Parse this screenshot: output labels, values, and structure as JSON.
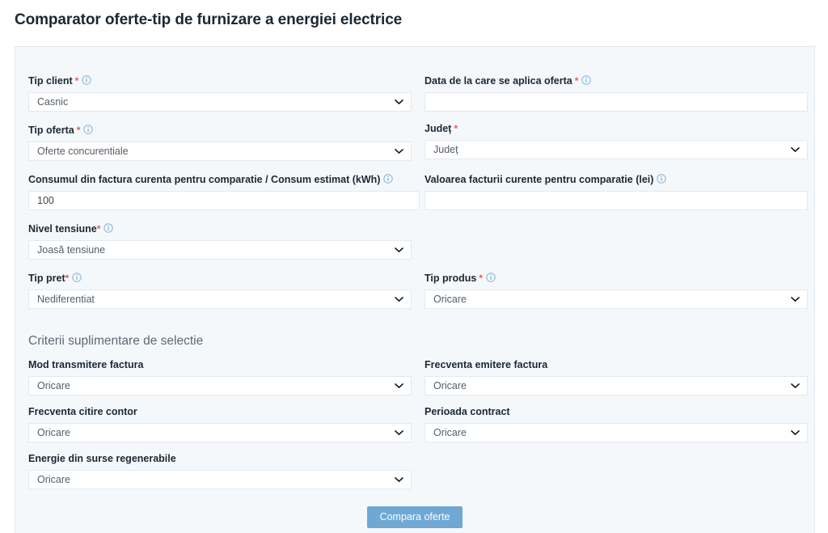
{
  "page": {
    "title": "Comparator oferte-tip de furnizare a energiei electrice"
  },
  "icons": {
    "info": "info-circle-icon",
    "chevron": "chevron-down-icon"
  },
  "colors": {
    "accent_button": "#6ea8d3",
    "required_asterisk": "#e45b5b",
    "card_background": "#f5f8fb",
    "info_icon": "#7fb3d9",
    "title_text": "#1b2733",
    "section_title": "#5d6975"
  },
  "form": {
    "tip_client": {
      "label": "Tip client",
      "required": true,
      "has_info": true,
      "value": "Casnic",
      "control": "select"
    },
    "data_oferta": {
      "label": "Data de la care se aplica oferta",
      "required": true,
      "has_info": true,
      "value": "",
      "placeholder": "",
      "control": "input"
    },
    "tip_oferta": {
      "label": "Tip oferta",
      "required": true,
      "has_info": true,
      "value": "Oferte concurentiale",
      "control": "select"
    },
    "judet": {
      "label": "Județ",
      "required": true,
      "has_info": false,
      "value": "Județ",
      "control": "select"
    },
    "consum": {
      "label": "Consumul din factura curenta pentru comparatie / Consum estimat (kWh)",
      "required": false,
      "has_info": true,
      "value": "100",
      "control": "input"
    },
    "valoare_factura": {
      "label": "Valoarea facturii curente pentru comparatie (lei)",
      "required": false,
      "has_info": true,
      "value": "",
      "placeholder": "",
      "control": "input"
    },
    "nivel_tensiune": {
      "label": "Nivel tensiune",
      "required": true,
      "has_info": true,
      "value": "Joasă tensiune",
      "control": "select"
    },
    "tip_pret": {
      "label": "Tip pret",
      "required": true,
      "has_info": true,
      "value": "Nediferentiat",
      "control": "select"
    },
    "tip_produs": {
      "label": "Tip produs",
      "required": true,
      "has_info": true,
      "value": "Oricare",
      "control": "select"
    }
  },
  "extra_section": {
    "title": "Criterii suplimentare de selectie",
    "fields": {
      "mod_transmitere": {
        "label": "Mod transmitere factura",
        "required": false,
        "has_info": false,
        "value": "Oricare",
        "control": "select"
      },
      "frecventa_emitere": {
        "label": "Frecventa emitere factura",
        "required": false,
        "has_info": false,
        "value": "Oricare",
        "control": "select"
      },
      "frecventa_citire": {
        "label": "Frecventa citire contor",
        "required": false,
        "has_info": false,
        "value": "Oricare",
        "control": "select"
      },
      "perioada_contract": {
        "label": "Perioada contract",
        "required": false,
        "has_info": false,
        "value": "Oricare",
        "control": "select"
      },
      "energie_regenerabila": {
        "label": "Energie din surse regenerabile",
        "required": false,
        "has_info": false,
        "value": "Oricare",
        "control": "select"
      }
    }
  },
  "actions": {
    "submit_label": "Compara oferte"
  }
}
